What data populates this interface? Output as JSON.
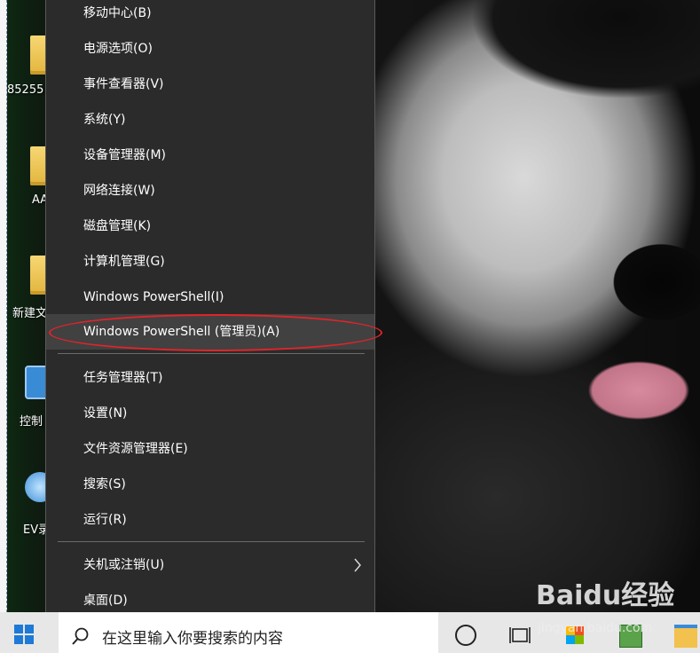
{
  "menu": {
    "items": [
      {
        "label": "移动中心(B)"
      },
      {
        "label": "电源选项(O)"
      },
      {
        "label": "事件查看器(V)"
      },
      {
        "label": "系统(Y)"
      },
      {
        "label": "设备管理器(M)"
      },
      {
        "label": "网络连接(W)"
      },
      {
        "label": "磁盘管理(K)"
      },
      {
        "label": "计算机管理(G)"
      },
      {
        "label": "Windows PowerShell(I)"
      },
      {
        "label": "Windows PowerShell (管理员)(A)"
      },
      {
        "label": "任务管理器(T)"
      },
      {
        "label": "设置(N)"
      },
      {
        "label": "文件资源管理器(E)"
      },
      {
        "label": "搜索(S)"
      },
      {
        "label": "运行(R)"
      },
      {
        "label": "关机或注销(U)"
      },
      {
        "label": "桌面(D)"
      }
    ],
    "highlighted_index": 9,
    "submenu_chevron_icon": "chevron-right-icon"
  },
  "desktop": {
    "icons": [
      {
        "label": "85255",
        "icon": "folder-icon"
      },
      {
        "label": "AA",
        "icon": "folder-icon"
      },
      {
        "label": "新建文",
        "icon": "folder-icon"
      },
      {
        "label": "控制",
        "icon": "control-panel-icon"
      },
      {
        "label": "EV录",
        "icon": "ev-recorder-icon"
      }
    ]
  },
  "taskbar": {
    "search_placeholder": "在这里输入你要搜索的内容",
    "icons": [
      "windows-start-icon",
      "search-icon",
      "cortana-icon",
      "task-view-icon",
      "store-icon",
      "photos-icon",
      "file-explorer-icon"
    ]
  },
  "watermark": {
    "text": "Baidu经验",
    "sub": "jingyan.baidu.com"
  },
  "colors": {
    "menu_bg": "#2b2b2b",
    "highlight": "#414141",
    "annotation": "#e0242a"
  }
}
